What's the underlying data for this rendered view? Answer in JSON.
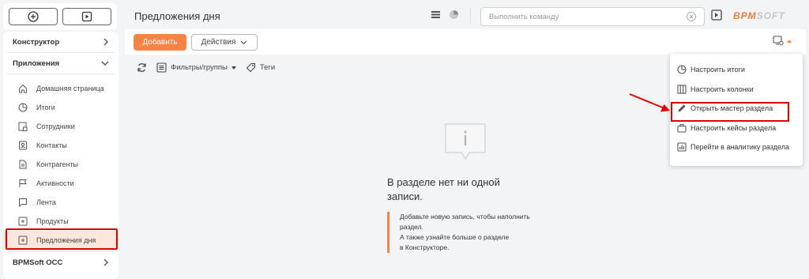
{
  "header": {
    "title": "Предложения дня",
    "command_placeholder": "Выполнить команду",
    "logo_a": "BPM",
    "logo_b": "SOFT"
  },
  "sidebar": {
    "sections": {
      "constructor": "Конструктор",
      "apps": "Приложения",
      "occ": "BPMSoft OCC"
    },
    "items": [
      {
        "label": "Домашняя страница",
        "icon": "home-icon"
      },
      {
        "label": "Итоги",
        "icon": "pie-chart-icon"
      },
      {
        "label": "Сотрудники",
        "icon": "employees-icon"
      },
      {
        "label": "Контакты",
        "icon": "contact-card-icon"
      },
      {
        "label": "Контрагенты",
        "icon": "document-icon"
      },
      {
        "label": "Активности",
        "icon": "flag-icon"
      },
      {
        "label": "Лента",
        "icon": "chat-icon"
      },
      {
        "label": "Продукты",
        "icon": "product-icon"
      },
      {
        "label": "Предложения дня",
        "icon": "offer-icon"
      }
    ]
  },
  "toolbar": {
    "add_label": "Добавить",
    "actions_label": "Действия"
  },
  "filters": {
    "filters_label": "Фильтры/группы",
    "tags_label": "Теги"
  },
  "empty": {
    "title": "В разделе нет ни одной записи.",
    "line1": "Добавьте новую запись, чтобы наполнить",
    "line2": "раздел.",
    "line3": "А также узнайте больше о разделе",
    "line4": "в Конструкторе."
  },
  "menu": {
    "items": [
      {
        "label": "Настроить итоги",
        "icon": "pie-chart-icon"
      },
      {
        "label": "Настроить колонки",
        "icon": "columns-icon"
      },
      {
        "label": "Открыть мастер раздела",
        "icon": "pencil-icon"
      },
      {
        "label": "Настроить кейсы раздела",
        "icon": "briefcase-icon"
      },
      {
        "label": "Перейти в аналитику раздела",
        "icon": "analytics-icon"
      }
    ]
  },
  "colors": {
    "accent": "#f58343",
    "highlight": "#e00000",
    "active_bg": "#fde7dd"
  }
}
